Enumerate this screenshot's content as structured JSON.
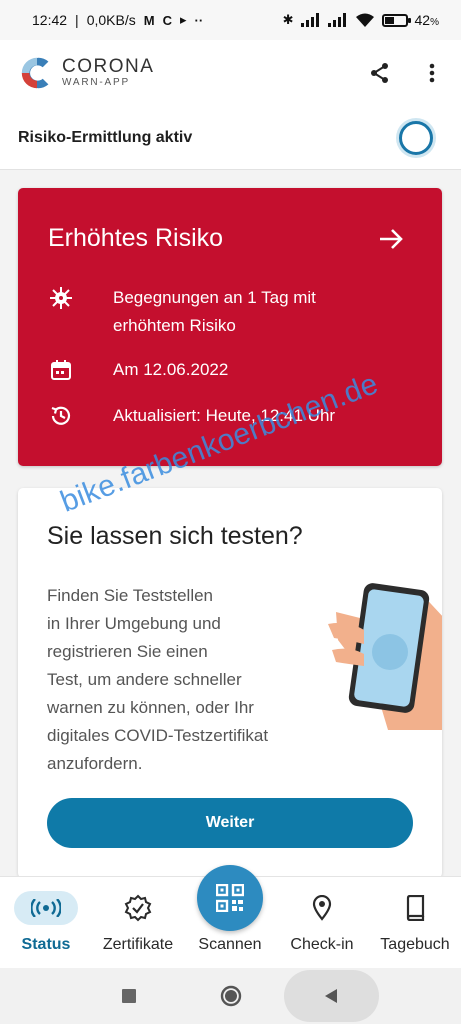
{
  "status_bar": {
    "time": "12:42",
    "net_speed": "0,0KB/s",
    "battery": "42",
    "battery_unit": "%",
    "battery_level": 0.42
  },
  "header": {
    "logo_line1": "CORONA",
    "logo_line2": "WARN-APP"
  },
  "risk_status": {
    "label": "Risiko-Ermittlung aktiv"
  },
  "risk_card": {
    "title": "Erhöhtes Risiko",
    "encounters_line1": "Begegnungen an 1 Tag mit",
    "encounters_line2": "erhöhtem Risiko",
    "date_text": "Am 12.06.2022",
    "updated_text": "Aktualisiert: Heute, 12:41 Uhr",
    "color": "#c40f2e"
  },
  "test_card": {
    "title": "Sie lassen sich testen?",
    "body_lines": [
      "Finden Sie Teststellen",
      "in Ihrer Umgebung und",
      "registrieren Sie einen",
      "Test, um andere schneller",
      "warnen zu können, oder Ihr",
      "digitales COVID-Testzertifikat",
      "anzufordern."
    ],
    "button_label": "Weiter",
    "button_color": "#0f7aa8"
  },
  "watermark": "bike.farbenkoerbchen.de",
  "bottom_nav": {
    "items": [
      {
        "label": "Status",
        "icon": "broadcast-icon",
        "active": true
      },
      {
        "label": "Zertifikate",
        "icon": "certificate-badge-icon",
        "active": false
      },
      {
        "label": "Scannen",
        "icon": "qr-code-icon",
        "active": false
      },
      {
        "label": "Check-in",
        "icon": "location-pin-icon",
        "active": false
      },
      {
        "label": "Tagebuch",
        "icon": "book-icon",
        "active": false
      }
    ],
    "accent": "#0f6a94"
  }
}
